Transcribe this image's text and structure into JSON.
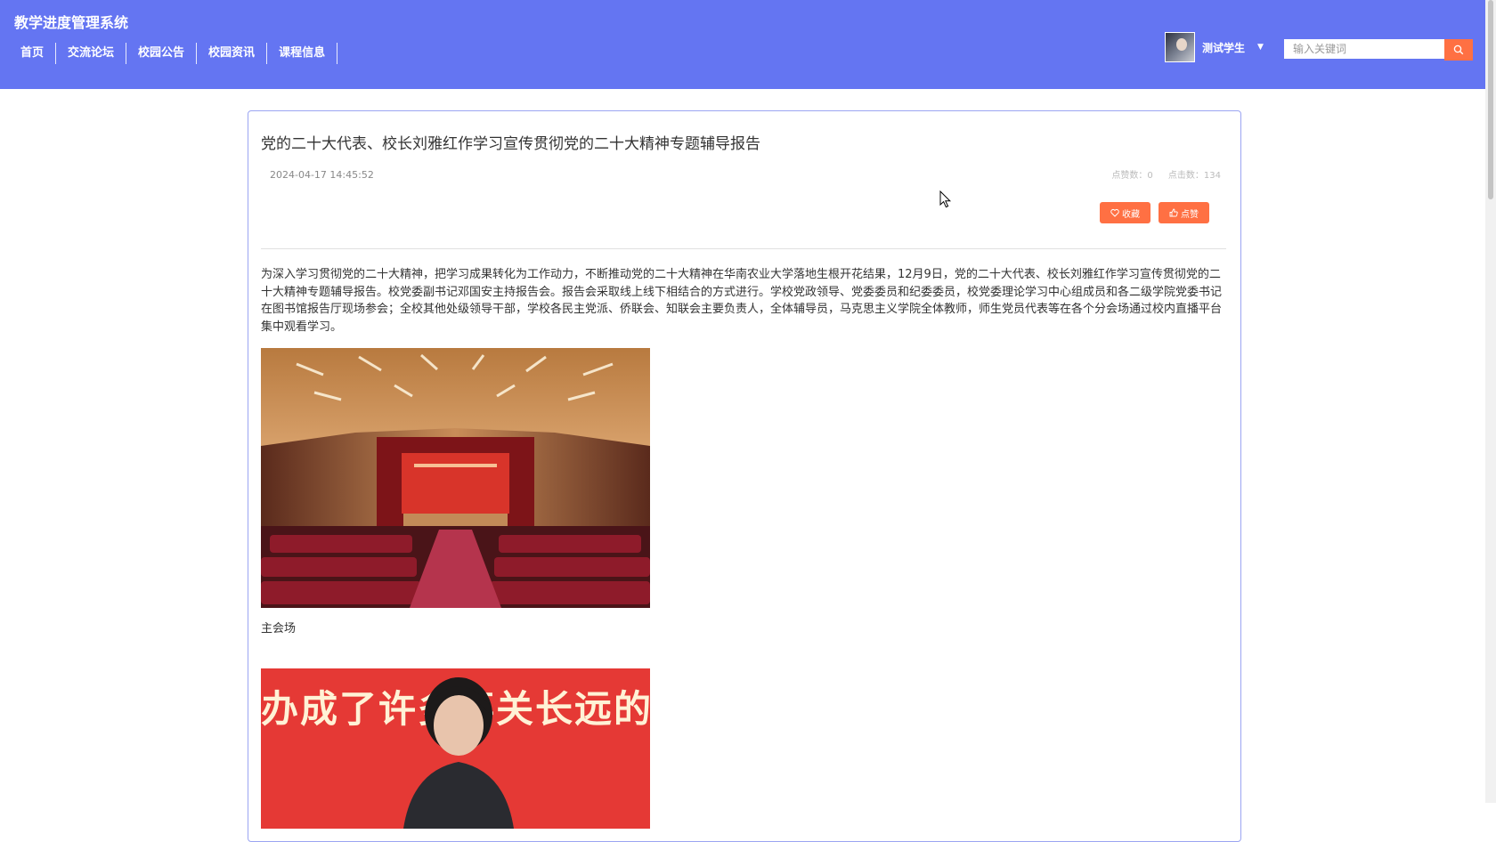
{
  "header": {
    "site_title": "教学进度管理系统",
    "nav": [
      "首页",
      "交流论坛",
      "校园公告",
      "校园资讯",
      "课程信息"
    ],
    "user": {
      "name": "测试学生"
    },
    "search": {
      "placeholder": "输入关键词"
    }
  },
  "article": {
    "title": "党的二十大代表、校长刘雅红作学习宣传贯彻党的二十大精神专题辅导报告",
    "date": "2024-04-17 14:45:52",
    "likes_label": "点赞数：0",
    "clicks_label": "点击数：134",
    "favorite_button": "收藏",
    "like_button": "点赞",
    "body": "为深入学习贯彻党的二十大精神，把学习成果转化为工作动力，不断推动党的二十大精神在华南农业大学落地生根开花结果，12月9日，党的二十大代表、校长刘雅红作学习宣传贯彻党的二十大精神专题辅导报告。校党委副书记邓国安主持报告会。报告会采取线上线下相结合的方式进行。学校党政领导、党委委员和纪委委员，校党委理论学习中心组成员和各二级学院党委书记在图书馆报告厅现场参会；全校其他处级领导干部，学校各民主党派、侨联会、知联会主要负责人，全体辅导员，马克思主义学院全体教师，师生党员代表等在各个分会场通过校内直播平台集中观看学习。",
    "caption1": "主会场",
    "photo2_banner_text": "办成了许多事关长远的大"
  },
  "colors": {
    "header_bg": "#6475f2",
    "accent": "#ff7043",
    "card_border": "#9ba5f2"
  }
}
